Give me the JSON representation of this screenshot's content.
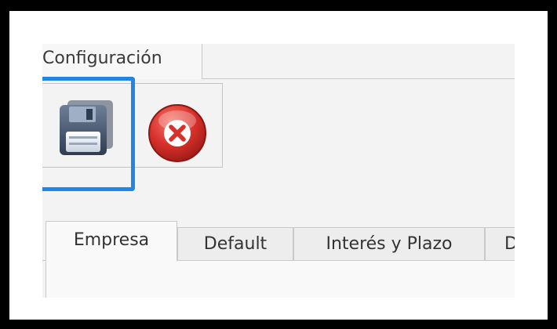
{
  "ribbon": {
    "tab_label": "Configuración"
  },
  "toolbar": {
    "save_icon": "floppy-disk-save-icon",
    "cancel_icon": "red-x-cancel-icon",
    "accent_color": "#1f86e6",
    "cancel_color": "#d8302b"
  },
  "tabs": {
    "items": [
      {
        "label": "Empresa",
        "active": true
      },
      {
        "label": "Default",
        "active": false
      },
      {
        "label": "Interés y Plazo",
        "active": false
      },
      {
        "label": "D",
        "active": false
      }
    ]
  }
}
